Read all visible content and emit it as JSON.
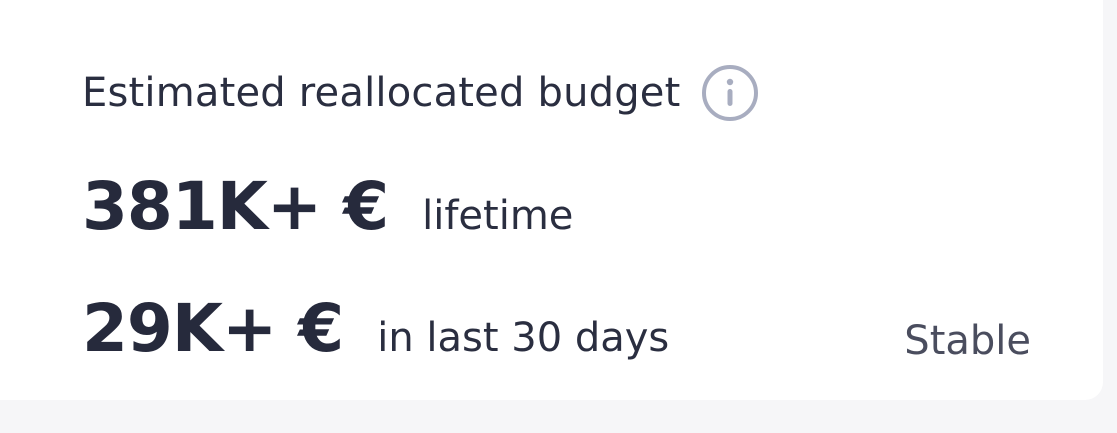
{
  "card": {
    "title": "Estimated reallocated budget",
    "info_icon": "info-circle-icon",
    "lifetime": {
      "amount": "381K+ €",
      "period": "lifetime"
    },
    "recent": {
      "amount": "29K+ €",
      "period": "in last 30 days"
    },
    "trend_status": "Stable"
  },
  "colors": {
    "text_primary": "#262a3c",
    "text_muted": "#4a4d5e",
    "icon": "#a8adc0",
    "background": "#ffffff"
  }
}
